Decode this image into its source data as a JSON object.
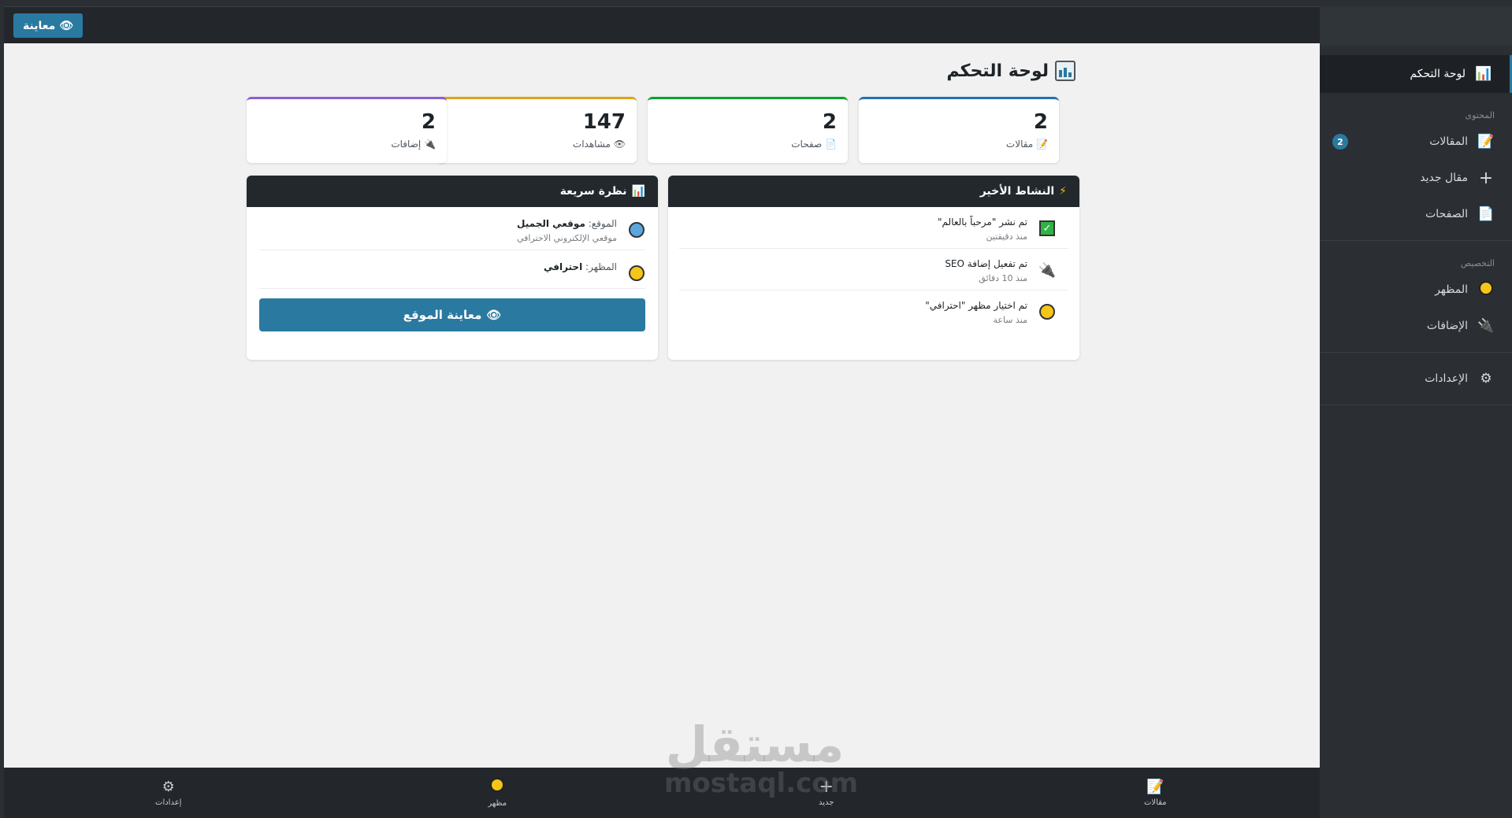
{
  "topbar": {
    "preview_label": "معاينة",
    "preview_icon": "eye-icon"
  },
  "sidebar": {
    "dashboard": "لوحة التحكم",
    "section_content": "المحتوى",
    "articles": "المقالات",
    "articles_badge": "2",
    "new_article": "مقال جديد",
    "pages": "الصفحات",
    "section_customize": "التخصيص",
    "appearance": "المظهر",
    "plugins": "الإضافات",
    "settings": "الإعدادات"
  },
  "page": {
    "title": "لوحة التحكم"
  },
  "stats": [
    {
      "value": "2",
      "label": "مقالات",
      "color": "#2271b1"
    },
    {
      "value": "2",
      "label": "صفحات",
      "color": "#00a32a"
    },
    {
      "value": "147",
      "label": "مشاهدات",
      "color": "#dba617"
    },
    {
      "value": "2",
      "label": "إضافات",
      "color": "#8c5fd6"
    }
  ],
  "activity": {
    "title": "النشاط الأخير",
    "items": [
      {
        "title": "تم نشر \"مرحباً بالعالم\"",
        "time": "منذ دقيقتين"
      },
      {
        "title": "تم تفعيل إضافة SEO",
        "time": "منذ 10 دقائق"
      },
      {
        "title": "تم اختيار مظهر \"احترافي\"",
        "time": "منذ ساعة"
      }
    ]
  },
  "quick": {
    "title": "نظرة سريعة",
    "site_label": "الموقع:",
    "site_value": "موقعي الجميل",
    "site_sub": "موقعي الإلكتروني الاحترافي",
    "theme_label": "المظهر:",
    "theme_value": "احترافي",
    "button": "معاينة الموقع"
  },
  "bottom_nav": {
    "settings": "إعدادات",
    "appearance": "مظهر",
    "new": "جديد",
    "articles": "مقالات"
  },
  "watermark": {
    "arabic": "مستقل",
    "latin": "mostaql.com"
  }
}
